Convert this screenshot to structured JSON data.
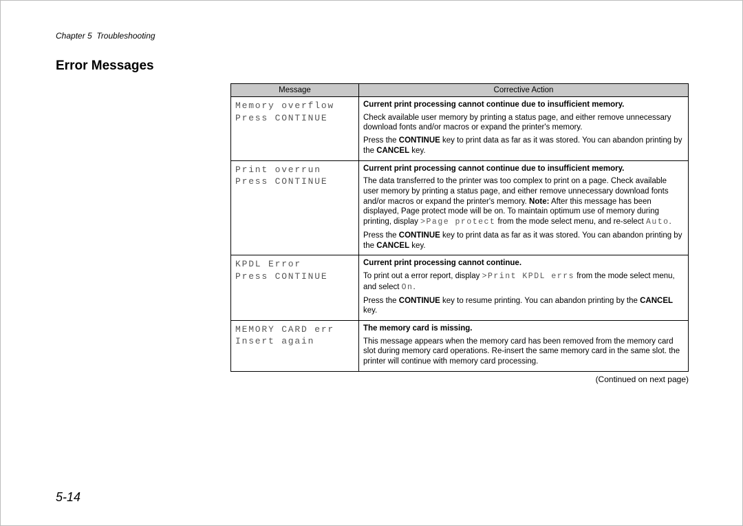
{
  "header": {
    "chapter": "Chapter 5",
    "section": "Troubleshooting"
  },
  "title": "Error Messages",
  "columns": {
    "message": "Message",
    "action": "Corrective Action"
  },
  "rows": [
    {
      "msg_line1": "Memory overflow",
      "msg_line2": "Press CONTINUE",
      "summary": "Current print processing cannot continue due to insufficient memory.",
      "p1": "Check available user memory by printing a status page, and either remove unnecessary download fonts and/or macros or expand the printer's memory.",
      "p2_a": "Press the ",
      "p2_k1": "CONTINUE",
      "p2_b": " key to print data as far as it was stored. You can abandon printing by the ",
      "p2_k2": "CANCEL",
      "p2_c": " key."
    },
    {
      "msg_line1": "Print overrun",
      "msg_line2": "Press CONTINUE",
      "summary": "Current print processing cannot continue due to insufficient memory.",
      "p1": "The data transferred to the printer was too complex to print on a page. Check available user memory by printing a status page, and either remove unnecessary download fonts and/or macros or expand the printer's memory. ",
      "note_label": "Note:",
      "note_body": " After this message has been displayed, Page protect mode will be on. To maintain optimum use of memory during printing, display ",
      "note_lcd1": ">Page protect",
      "note_mid": " from the mode select menu, and re-select ",
      "note_lcd2": "Auto",
      "note_end": ".",
      "p2_a": "Press the ",
      "p2_k1": "CONTINUE",
      "p2_b": " key to print data as far as it was stored. You can abandon printing by the ",
      "p2_k2": "CANCEL",
      "p2_c": " key."
    },
    {
      "msg_line1": "KPDL Error",
      "msg_line2": "Press CONTINUE",
      "summary": "Current print processing cannot continue.",
      "p1_a": "To print out a error report, display ",
      "p1_lcd": ">Print KPDL errs",
      "p1_b": " from the mode select menu, and select ",
      "p1_lcd2": "On",
      "p1_c": ".",
      "p2_a": "Press the ",
      "p2_k1": "CONTINUE",
      "p2_b": " key to resume printing. You can abandon printing by the ",
      "p2_k2": "CANCEL",
      "p2_c": " key."
    },
    {
      "msg_line1": "MEMORY CARD err",
      "msg_line2": "Insert again",
      "summary": "The memory card is missing.",
      "p1": "This message appears when the memory card has been removed from the memory card slot during memory card operations.  Re-insert the same memory card in the same slot.  the printer will continue with memory card processing."
    }
  ],
  "continued": "(Continued on next page)",
  "page_number": "5-14"
}
